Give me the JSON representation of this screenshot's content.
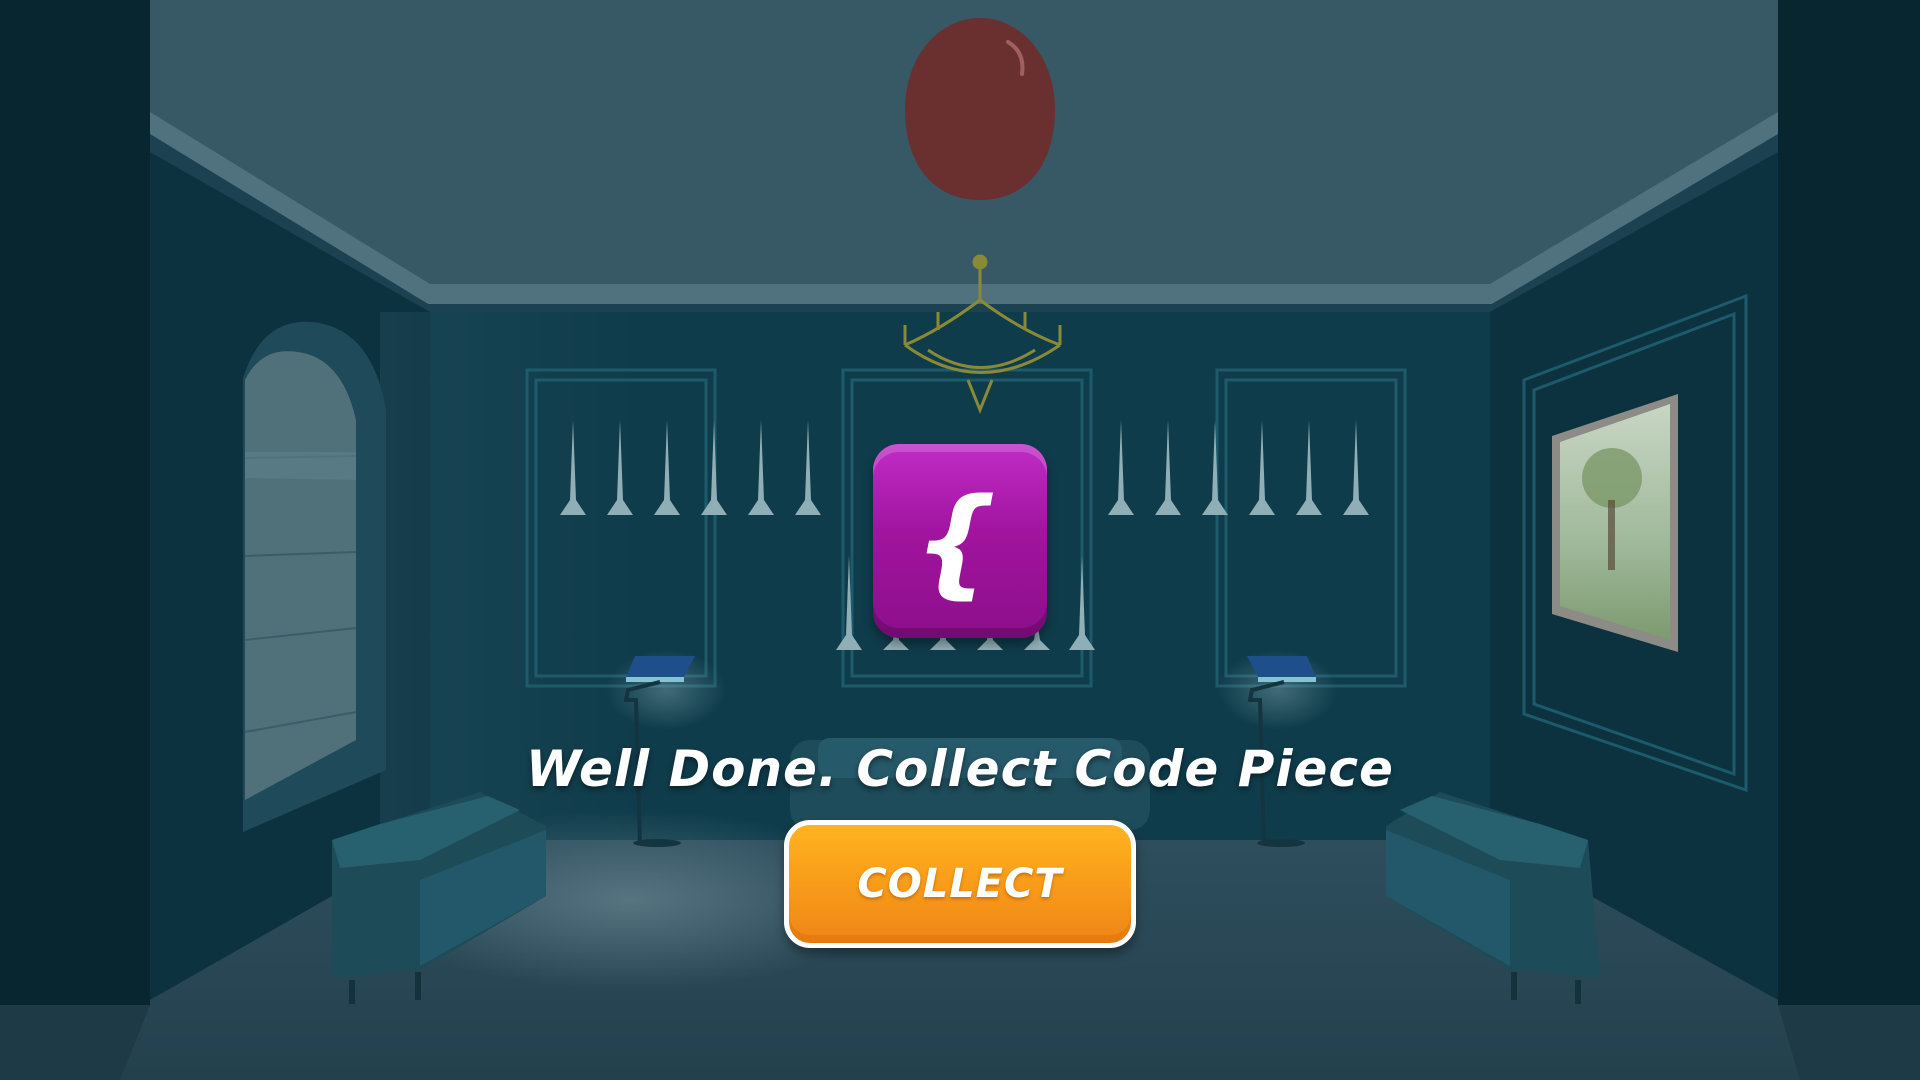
{
  "scene": {
    "colors": {
      "ceiling": "#365965",
      "back_wall": "#0f3c4b",
      "side_wall": "#0c3240",
      "pillar": "#082630",
      "floor": "#2d4c5b",
      "balloon": "#6a3030",
      "window_glass": "#50707a"
    },
    "icons": [
      "balloon-icon",
      "chandelier-icon",
      "floor-lamp-icon",
      "sofa-icon",
      "window-icon",
      "painting-icon",
      "spike-icon"
    ]
  },
  "reward": {
    "tile_glyph": "{",
    "tile_color": "#a1149f",
    "message": "Well Done. Collect Code Piece",
    "button_label": "COLLECT",
    "button_color": "#f79a19"
  }
}
